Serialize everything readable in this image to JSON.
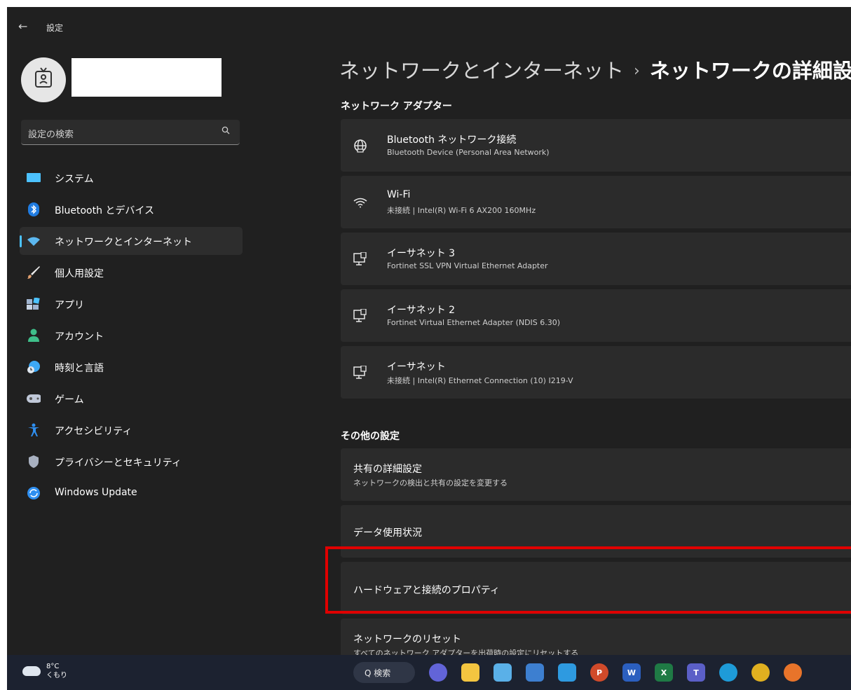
{
  "window": {
    "title": "設定",
    "back_icon": "←"
  },
  "account": {
    "avatar_icon": "id-badge"
  },
  "search": {
    "placeholder": "設定の検索",
    "icon": "🔍"
  },
  "sidebar": {
    "items": [
      {
        "label": "システム",
        "icon": "monitor",
        "color": "#4cc2ff"
      },
      {
        "label": "Bluetooth とデバイス",
        "icon": "bluetooth",
        "color": "#1f7be0"
      },
      {
        "label": "ネットワークとインターネット",
        "icon": "wifi",
        "color": "#5cb8f0",
        "active": true
      },
      {
        "label": "個人用設定",
        "icon": "brush",
        "color": "#e0a070"
      },
      {
        "label": "アプリ",
        "icon": "apps",
        "color": "#a0b4d0"
      },
      {
        "label": "アカウント",
        "icon": "person",
        "color": "#3fbf8a"
      },
      {
        "label": "時刻と言語",
        "icon": "globe-clock",
        "color": "#3da8f5"
      },
      {
        "label": "ゲーム",
        "icon": "gamepad",
        "color": "#c0c8d8"
      },
      {
        "label": "アクセシビリティ",
        "icon": "accessibility",
        "color": "#2f8ff0"
      },
      {
        "label": "プライバシーとセキュリティ",
        "icon": "shield",
        "color": "#a8b0c0"
      },
      {
        "label": "Windows Update",
        "icon": "update",
        "color": "#2f8ff0"
      }
    ]
  },
  "breadcrumb": {
    "parent": "ネットワークとインターネット",
    "separator": "›",
    "current": "ネットワークの詳細設定"
  },
  "adapters_section": {
    "title": "ネットワーク アダプター",
    "items": [
      {
        "title": "Bluetooth ネットワーク接続",
        "subtitle": "Bluetooth Device (Personal Area Network)",
        "icon": "globe-network-icon"
      },
      {
        "title": "Wi-Fi",
        "subtitle": "未接続 | Intel(R) Wi-Fi 6 AX200 160MHz",
        "icon": "wifi-icon"
      },
      {
        "title": "イーサネット 3",
        "subtitle": "Fortinet SSL VPN Virtual Ethernet Adapter",
        "icon": "ethernet-icon"
      },
      {
        "title": "イーサネット 2",
        "subtitle": "Fortinet Virtual Ethernet Adapter (NDIS 6.30)",
        "icon": "ethernet-icon"
      },
      {
        "title": "イーサネット",
        "subtitle": "未接続 | Intel(R) Ethernet Connection (10) I219-V",
        "icon": "ethernet-icon"
      }
    ]
  },
  "other_section": {
    "title": "その他の設定",
    "items": [
      {
        "title": "共有の詳細設定",
        "subtitle": "ネットワークの検出と共有の設定を変更する"
      },
      {
        "title": "データ使用状況",
        "subtitle": ""
      },
      {
        "title": "ハードウェアと接続のプロパティ",
        "subtitle": ""
      },
      {
        "title": "ネットワークのリセット",
        "subtitle": "すべてのネットワーク アダプターを出荷時の設定にリセットする"
      }
    ]
  },
  "taskbar": {
    "weather_temp": "8°C",
    "weather_desc": "くもり",
    "search_label": "Q 検索"
  }
}
